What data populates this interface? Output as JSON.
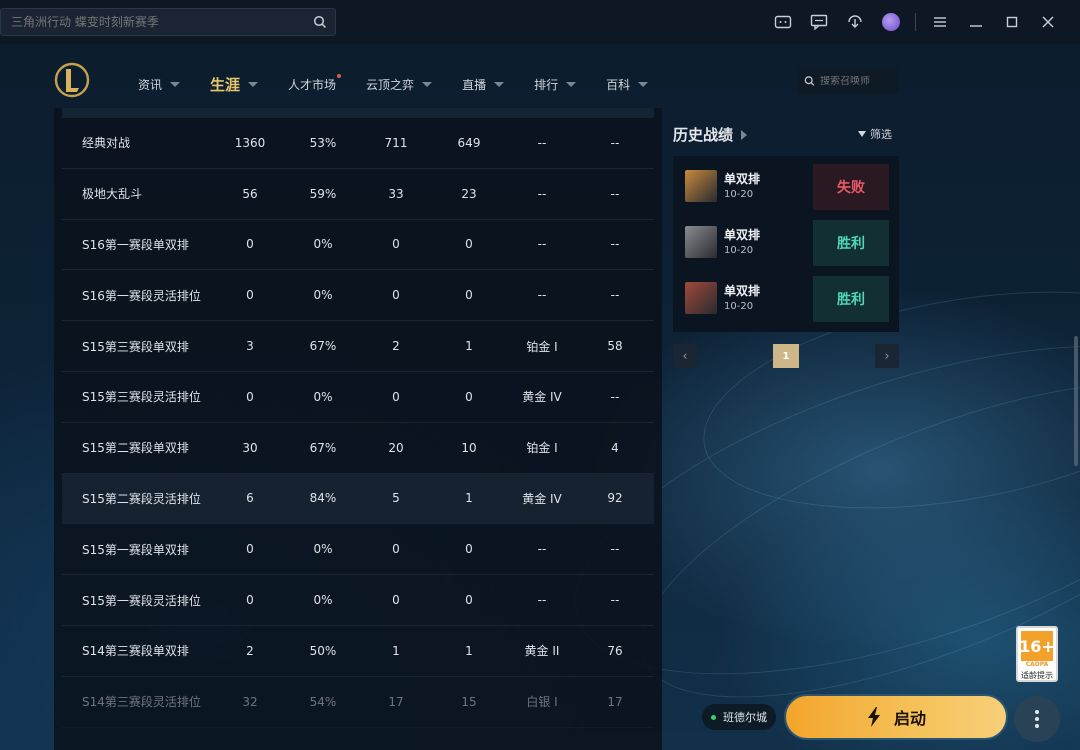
{
  "topbar": {
    "search_placeholder": "三角洲行动 蝶变时刻新赛季"
  },
  "nav": {
    "items": [
      {
        "label": "资讯",
        "caret": true
      },
      {
        "label": "生涯",
        "caret": true,
        "active": true
      },
      {
        "label": "人才市场",
        "dot": true
      },
      {
        "label": "云顶之弈",
        "caret": true
      },
      {
        "label": "直播",
        "caret": true
      },
      {
        "label": "排行",
        "caret": true
      },
      {
        "label": "百科",
        "caret": true
      }
    ],
    "summoner_search_placeholder": "搜索召唤师"
  },
  "table": {
    "rows": [
      {
        "mode": "经典对战",
        "total": "1360",
        "winrate": "53%",
        "wins": "711",
        "losses": "649",
        "tier": "--",
        "points": "--"
      },
      {
        "mode": "极地大乱斗",
        "total": "56",
        "winrate": "59%",
        "wins": "33",
        "losses": "23",
        "tier": "--",
        "points": "--"
      },
      {
        "mode": "S16第一赛段单双排",
        "total": "0",
        "winrate": "0%",
        "wins": "0",
        "losses": "0",
        "tier": "--",
        "points": "--"
      },
      {
        "mode": "S16第一赛段灵活排位",
        "total": "0",
        "winrate": "0%",
        "wins": "0",
        "losses": "0",
        "tier": "--",
        "points": "--"
      },
      {
        "mode": "S15第三赛段单双排",
        "total": "3",
        "winrate": "67%",
        "wins": "2",
        "losses": "1",
        "tier": "铂金 I",
        "points": "58"
      },
      {
        "mode": "S15第三赛段灵活排位",
        "total": "0",
        "winrate": "0%",
        "wins": "0",
        "losses": "0",
        "tier": "黄金 IV",
        "points": "--"
      },
      {
        "mode": "S15第二赛段单双排",
        "total": "30",
        "winrate": "67%",
        "wins": "20",
        "losses": "10",
        "tier": "铂金 I",
        "points": "4"
      },
      {
        "mode": "S15第二赛段灵活排位",
        "total": "6",
        "winrate": "84%",
        "wins": "5",
        "losses": "1",
        "tier": "黄金 IV",
        "points": "92"
      },
      {
        "mode": "S15第一赛段单双排",
        "total": "0",
        "winrate": "0%",
        "wins": "0",
        "losses": "0",
        "tier": "--",
        "points": "--"
      },
      {
        "mode": "S15第一赛段灵活排位",
        "total": "0",
        "winrate": "0%",
        "wins": "0",
        "losses": "0",
        "tier": "--",
        "points": "--"
      },
      {
        "mode": "S14第三赛段单双排",
        "total": "2",
        "winrate": "50%",
        "wins": "1",
        "losses": "1",
        "tier": "黄金 II",
        "points": "76"
      },
      {
        "mode": "S14第三赛段灵活排位",
        "total": "32",
        "winrate": "54%",
        "wins": "17",
        "losses": "15",
        "tier": "白银 I",
        "points": "17"
      }
    ]
  },
  "history": {
    "title": "历史战绩",
    "filter_label": "筛选",
    "matches": [
      {
        "mode": "单双排",
        "date": "10-20",
        "result": "失败",
        "outcome": "lose",
        "champ_color": "#c98a3c"
      },
      {
        "mode": "单双排",
        "date": "10-20",
        "result": "胜利",
        "outcome": "win",
        "champ_color": "#8a8c92"
      },
      {
        "mode": "单双排",
        "date": "10-20",
        "result": "胜利",
        "outcome": "win",
        "champ_color": "#a04a3a"
      }
    ],
    "pager": {
      "current_page": "1",
      "prev": "‹",
      "next": "›"
    }
  },
  "bottom": {
    "server": "班德尔城",
    "launch_label": "启动",
    "age_rating": "16+",
    "age_org": "CADPA",
    "age_tip": "适龄提示"
  },
  "colors": {
    "accent_gold": "#e6c56b",
    "win": "#4fd6b6",
    "lose": "#e65b66",
    "launch": "#f5b241"
  }
}
